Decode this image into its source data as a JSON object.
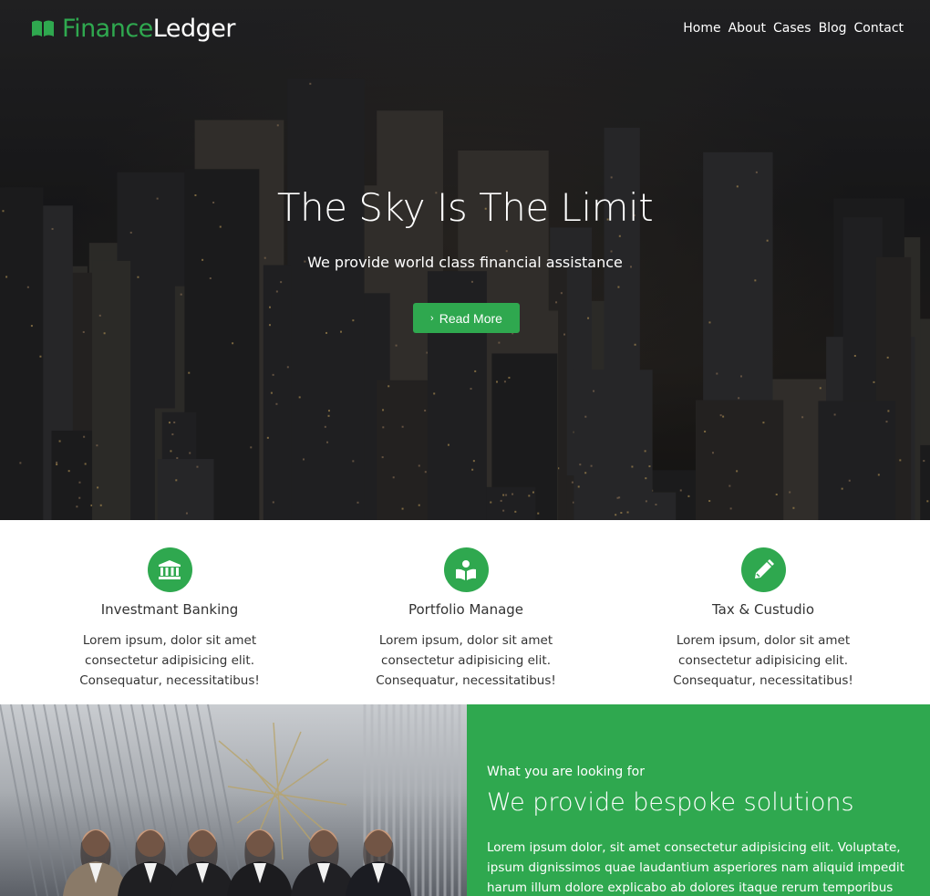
{
  "brand": {
    "part1": "Finance",
    "part2": "Ledger",
    "icon": "open-book-icon"
  },
  "nav": {
    "items": [
      "Home",
      "About",
      "Cases",
      "Blog",
      "Contact"
    ]
  },
  "hero": {
    "title": "The Sky Is The Limit",
    "subtitle": "We provide world class financial assistance",
    "button_label": "Read More",
    "button_icon": "chevron-right-icon"
  },
  "features": [
    {
      "icon": "bank-icon",
      "title": "Investmant Banking",
      "text": "Lorem ipsum, dolor sit amet consectetur adipisicing elit. Consequatur, necessitatibus!"
    },
    {
      "icon": "book-reader-icon",
      "title": "Portfolio Manage",
      "text": "Lorem ipsum, dolor sit amet consectetur adipisicing elit. Consequatur, necessitatibus!"
    },
    {
      "icon": "pencil-icon",
      "title": "Tax & Custudio",
      "text": "Lorem ipsum, dolor sit amet consectetur adipisicing elit. Consequatur, necessitatibus!"
    }
  ],
  "solutions": {
    "eyebrow": "What you are looking for",
    "title": "We provide bespoke solutions",
    "text": "Lorem ipsum dolor, sit amet consectetur adipisicing elit. Voluptate, ipsum dignissimos quae laudantium asperiores nam aliquid impedit harum illum dolore explicabo ab dolores itaque rerum temporibus"
  },
  "colors": {
    "accent": "#2fa84f",
    "text": "#333333"
  }
}
